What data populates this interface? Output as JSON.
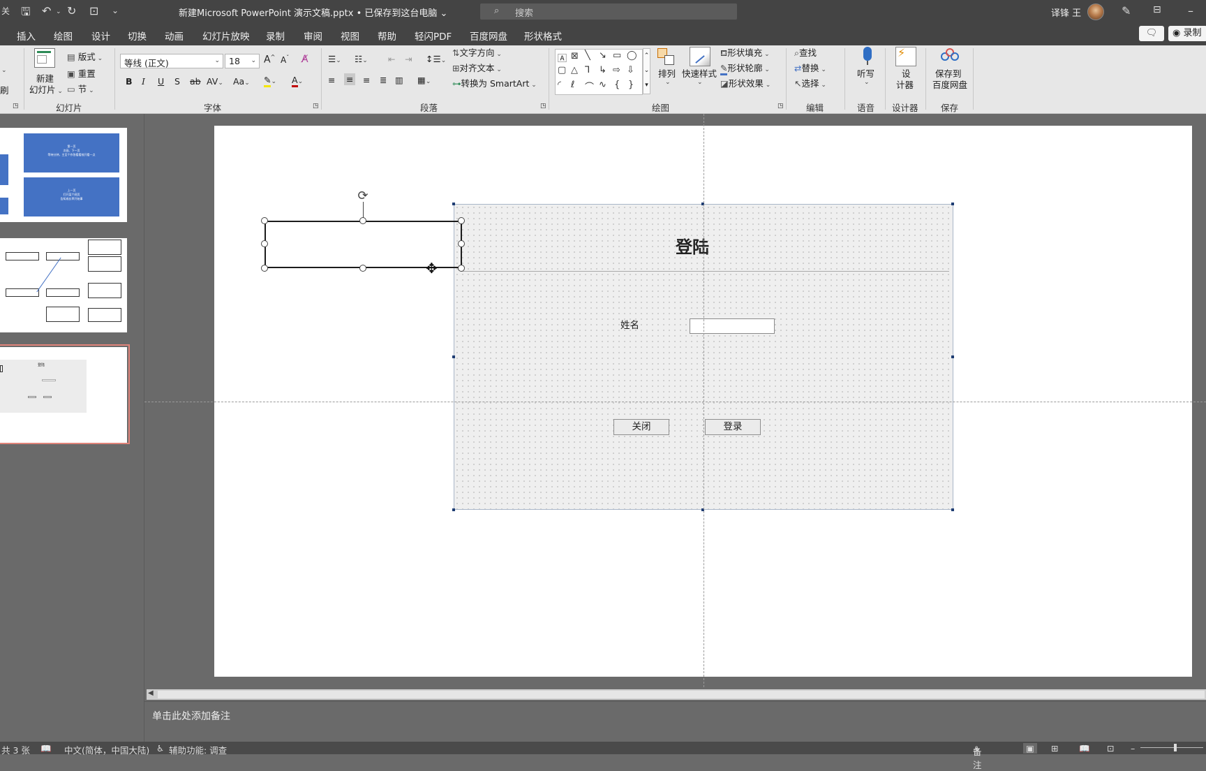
{
  "titlebar": {
    "autosave_label": "关",
    "doc_title": "新建Microsoft PowerPoint 演示文稿.pptx • 已保存到这台电脑 ⌄",
    "search_placeholder": "搜索",
    "user_name": "译锋 王"
  },
  "menu": {
    "tabs": [
      "插入",
      "绘图",
      "设计",
      "切换",
      "动画",
      "幻灯片放映",
      "录制",
      "审阅",
      "视图",
      "帮助",
      "轻闪PDF",
      "百度网盘",
      "形状格式"
    ],
    "record_label": "录制"
  },
  "ribbon": {
    "groups": {
      "slides": "幻灯片",
      "font": "字体",
      "paragraph": "段落",
      "drawing": "绘图",
      "editing": "编辑",
      "voice": "语音",
      "designer": "设计器",
      "save": "保存"
    },
    "slides": {
      "new_slide_line1": "新建",
      "new_slide_line2": "幻灯片",
      "layout": "版式",
      "reset": "重置",
      "section": "节",
      "brush": "刷"
    },
    "font": {
      "family": "等线 (正文)",
      "size": "18"
    },
    "paragraph": {
      "text_direction": "文字方向",
      "align_text": "对齐文本",
      "smartart": "转换为 SmartArt"
    },
    "drawing": {
      "arrange": "排列",
      "quick_styles": "快速样式",
      "fill": "形状填充",
      "outline": "形状轮廓",
      "effects": "形状效果"
    },
    "editing": {
      "find": "查找",
      "replace": "替换",
      "select": "选择"
    },
    "voice": {
      "dictate": "听写"
    },
    "designer": {
      "line1": "设",
      "line2": "计器"
    },
    "save": {
      "line1": "保存到",
      "line2": "百度网盘"
    }
  },
  "thumbnails": {
    "slide1": {
      "top_text": "第一页\n次画、下一页\n等待分钟，主至个作答看看效开看一点",
      "bottom_text": "上一页\n打开某个网页\n告知成长率开始事"
    },
    "slide3": {
      "title": "登陆"
    }
  },
  "slide": {
    "form_title": "登陆",
    "name_label": "姓名",
    "close_button": "关闭",
    "login_button": "登录"
  },
  "notes": {
    "placeholder": "单击此处添加备注"
  },
  "status": {
    "slide_count": "共 3 张",
    "language": "中文(简体，中国大陆)",
    "accessibility": "辅助功能: 调查",
    "notes_button": "备注"
  },
  "colors": {
    "title_bg": "#444444",
    "ribbon_bg": "#e7e7e7",
    "workspace_bg": "#6a6a6a",
    "thumb_blue": "#4472c4",
    "selected_thumb_border": "#e0847a"
  }
}
